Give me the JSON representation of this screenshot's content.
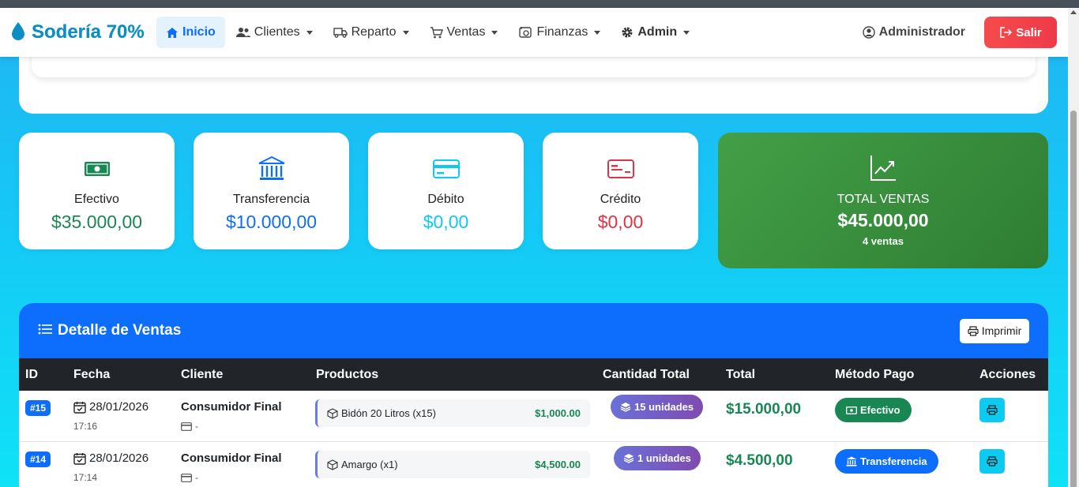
{
  "brand": {
    "name": "Sodería 70%"
  },
  "nav": {
    "inicio": "Inicio",
    "clientes": "Clientes",
    "reparto": "Reparto",
    "ventas": "Ventas",
    "finanzas": "Finanzas",
    "admin": "Admin"
  },
  "user": {
    "name": "Administrador",
    "logout": "Salir"
  },
  "stats": {
    "efectivo": {
      "label": "Efectivo",
      "value": "$35.000,00",
      "color": "#198754"
    },
    "transferencia": {
      "label": "Transferencia",
      "value": "$10.000,00",
      "color": "#0d6efd"
    },
    "debito": {
      "label": "Débito",
      "value": "$0,00",
      "color": "#0dcaf0"
    },
    "credito": {
      "label": "Crédito",
      "value": "$0,00",
      "color": "#dc3545"
    },
    "total": {
      "label": "TOTAL VENTAS",
      "value": "$45.000,00",
      "count": "4 ventas"
    }
  },
  "detail": {
    "title": "Detalle de Ventas",
    "print": "Imprimir",
    "columns": [
      "ID",
      "Fecha",
      "Cliente",
      "Productos",
      "Cantidad Total",
      "Total",
      "Método Pago",
      "Acciones"
    ],
    "rows": [
      {
        "id": "#15",
        "date": "28/01/2026",
        "time": "17:16",
        "client": "Consumidor Final",
        "client_sub": "-",
        "product": "Bidón 20 Litros (x15)",
        "product_price": "$1,000.00",
        "units": "15 unidades",
        "total": "$15.000,00",
        "payment": "Efectivo",
        "payment_color": "#198754"
      },
      {
        "id": "#14",
        "date": "28/01/2026",
        "time": "17:14",
        "client": "Consumidor Final",
        "client_sub": "-",
        "product": "Amargo (x1)",
        "product_price": "$4,500.00",
        "units": "1 unidades",
        "total": "$4.500,00",
        "payment": "Transferencia",
        "payment_color": "#0d6efd"
      }
    ]
  }
}
